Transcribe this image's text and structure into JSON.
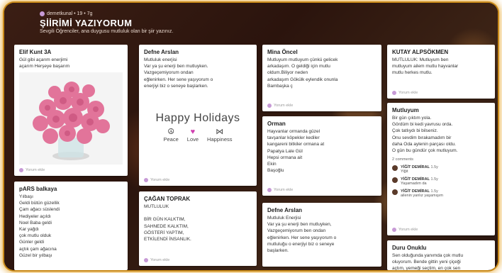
{
  "header": {
    "author_meta": "demetkunal • 19 • 7g",
    "title": "ŞİİRİMİ YAZIYORUM",
    "subtitle": "Sevgili Öğrenciler, ana duygusu mutluluk olan bir şiir yazınız."
  },
  "reply_label": "Yorum ekle",
  "cards": [
    {
      "author": "Elif Kunt 3A",
      "body": "Gül gibi açarım enerjimi\naçarım Herşeye başarım"
    },
    {
      "author": "pARS balkaya",
      "body": "Yılbaşı\nGeldi bütün güzellik\nÇam ağacı süslendi\nHediyeler açıldı\nNoel Baba geldi\nKar yağdı\nçok mutlu olduk\nGünler geldi\naçtık çam ağacına\nGüzel bir yılbaşı"
    },
    {
      "author": "Defne Arslan",
      "body": "Mutluluk enerjisi\nVar ya şu enerji ben mutluyken.\nVazgeçemiyorum ondan\neğlenirken. Her sene yaşıyorum o\nenerjiyi biz o seneye başlarken."
    },
    {
      "author": "ÇAĞAN TOPRAK",
      "body": "MUTLULUK\n\nBİR GÜN KALKTIM,\nSAHNEDE KALKTIM,\nGÖSTERİ YAPTIM,\nETKİLENDİ İNSANLIK."
    },
    {
      "author": "Mina Öncel",
      "body": "Mutluyum mutluyum çünkü gelicek\narkadaşım. O geldiği için mutlu\noldum.Biliyor neden\narkadaşım Gökülk eylendik onunla\nBambaşka ç"
    },
    {
      "author": "Orman",
      "body": "Hayvanlar ormanda güzel\ntavşanlar köpekler kediler\nkangareni bitkiler ormana at\nPapatya Lale Gül\nHepsi ormana ait\n                                    Ekin\nBaşoğlu"
    },
    {
      "author": "Defne Arslan",
      "body": "Mutluluk Enerjisi\nVar ya şu enerji ben mutluyken,\nVazgeçemiyorum ben ondan\neğlenirken. Her sene yaşıyorum o\nmutluluğu o enerjiyi biz o seneye\nbaşlarken."
    },
    {
      "author": "KUTAY ALPSÖKMEN",
      "body": "MUTLULUK: Mutluyum ben\nmutluyum ailem mutlu hayvanlar\nmutlu herkes mutlu."
    },
    {
      "author": "Mutluyum",
      "body": "Bir gün çıktım yola.\nGördüm bi kedi yavrusu orda.\nÇok tatlıydı bi bilseniz.\nOnu sevdim bırakamadım bir\ndaha Oda aylenin parçası oldu.\nO gün bu gündür çok mutluyum."
    },
    {
      "author": "Duru Onuklu",
      "body": "Sen olduğunda yanımda çok mutlu\noluyorum. Bende gittin yeni çiçeği\naçtım, yemeği seçtim, en çok sen"
    }
  ],
  "holiday": {
    "title": "Happy Holidays",
    "peace": "Peace",
    "love": "Love",
    "happiness": "Happiness"
  },
  "comments": {
    "count": "2 comments",
    "items": [
      {
        "name": "YİĞİT DEMİRAL",
        "time": "1.5y",
        "text": "Yiğit"
      },
      {
        "name": "YİĞİT DEMİRAL",
        "time": "1.5y",
        "text": "Yaşamadım da"
      },
      {
        "name": "YİĞİT DEMİRAL",
        "time": "1.5y",
        "text": "ailenin yanlız yaşamışım"
      }
    ]
  }
}
